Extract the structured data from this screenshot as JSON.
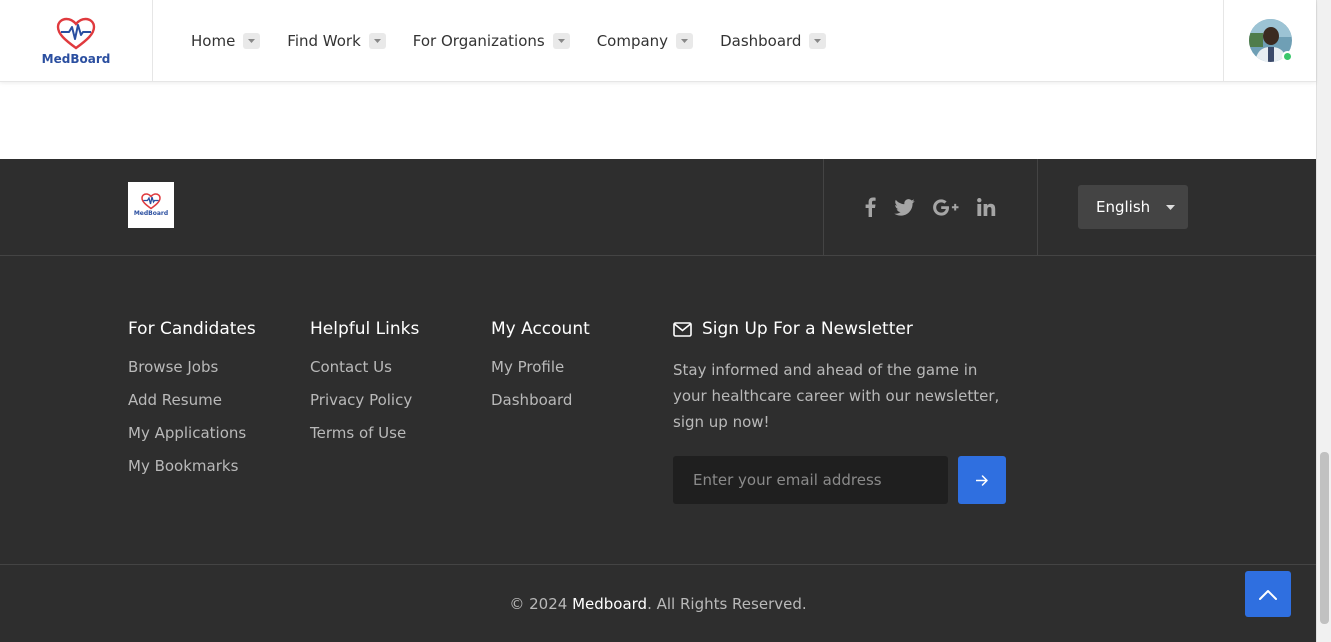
{
  "header": {
    "logo_text": "MedBoard",
    "nav": [
      {
        "label": "Home"
      },
      {
        "label": "Find Work"
      },
      {
        "label": "For Organizations"
      },
      {
        "label": "Company"
      },
      {
        "label": "Dashboard"
      }
    ],
    "avatar_status_color": "#3ac76b"
  },
  "footer": {
    "logo_text": "MedBoard",
    "social_icons": [
      "facebook-icon",
      "twitter-icon",
      "google-plus-icon",
      "linkedin-icon"
    ],
    "language": "English",
    "columns": [
      {
        "title": "For Candidates",
        "links": [
          "Browse Jobs",
          "Add Resume",
          "My Applications",
          "My Bookmarks"
        ]
      },
      {
        "title": "Helpful Links",
        "links": [
          "Contact Us",
          "Privacy Policy",
          "Terms of Use"
        ]
      },
      {
        "title": "My Account",
        "links": [
          "My Profile",
          "Dashboard"
        ]
      }
    ],
    "newsletter": {
      "title": "Sign Up For a Newsletter",
      "description": "Stay informed and ahead of the game in your healthcare career with our newsletter, sign up now!",
      "placeholder": "Enter your email address",
      "icon": "envelope-icon",
      "submit_icon": "arrow-right-icon"
    },
    "copyright": {
      "prefix": "© 2024 ",
      "brand": "Medboard",
      "suffix": ". All Rights Reserved."
    }
  },
  "back_to_top_icon": "chevron-up-icon",
  "colors": {
    "accent": "#2f6fe0",
    "footer_bg": "#2e2e2e",
    "logo_red": "#e03a3e",
    "logo_blue": "#2b4fa0"
  }
}
